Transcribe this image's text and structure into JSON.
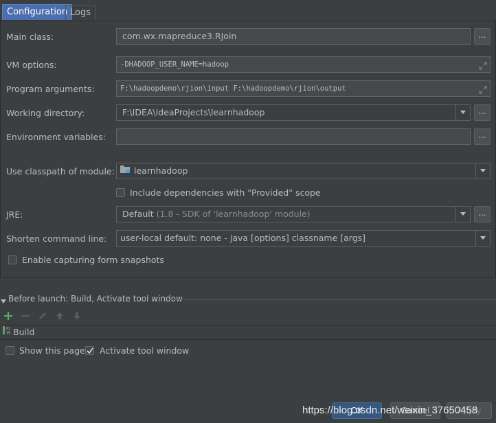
{
  "tabs": [
    {
      "label": "Configuration",
      "active": true
    },
    {
      "label": "Logs",
      "active": false
    }
  ],
  "form": {
    "main_class": {
      "label": "Main class:",
      "value": "com.wx.mapreduce3.RJoin"
    },
    "vm_options": {
      "label": "VM options:",
      "value": "-DHADOOP_USER_NAME=hadoop"
    },
    "program_arguments": {
      "label": "Program arguments:",
      "value": "F:\\hadoopdemo\\rjion\\input  F:\\hadoopdemo\\rjion\\output"
    },
    "working_directory": {
      "label": "Working directory:",
      "value": "F:\\IDEA\\IdeaProjects\\learnhadoop"
    },
    "environment_variables": {
      "label": "Environment variables:",
      "value": ""
    },
    "classpath_module": {
      "label": "Use classpath of module:",
      "value": "learnhadoop"
    },
    "include_provided": {
      "label": "Include dependencies with \"Provided\" scope",
      "checked": false
    },
    "jre": {
      "label": "JRE:",
      "value": "Default",
      "hint": "(1.8 - SDK of 'learnhadoop' module)"
    },
    "shorten_command_line": {
      "label": "Shorten command line:",
      "value": "user-local default: none - java [options] classname [args]"
    },
    "enable_snapshots": {
      "label": "Enable capturing form snapshots",
      "checked": false
    },
    "browse_label": "..."
  },
  "before_launch": {
    "header": "Before launch: Build, Activate tool window",
    "tasks": [
      {
        "label": "Build"
      }
    ]
  },
  "options": {
    "show_this_page": {
      "label": "Show this page",
      "checked": false
    },
    "activate_tool_window": {
      "label": "Activate tool window",
      "checked": true
    }
  },
  "buttons": {
    "ok": "OK",
    "cancel": "Cancel",
    "apply": "Apply"
  },
  "watermark": "https://blog.csdn.net/weixin_37650458",
  "colors": {
    "background": "#3c3f41",
    "accent": "#4b6eaf",
    "add": "#59a869"
  }
}
